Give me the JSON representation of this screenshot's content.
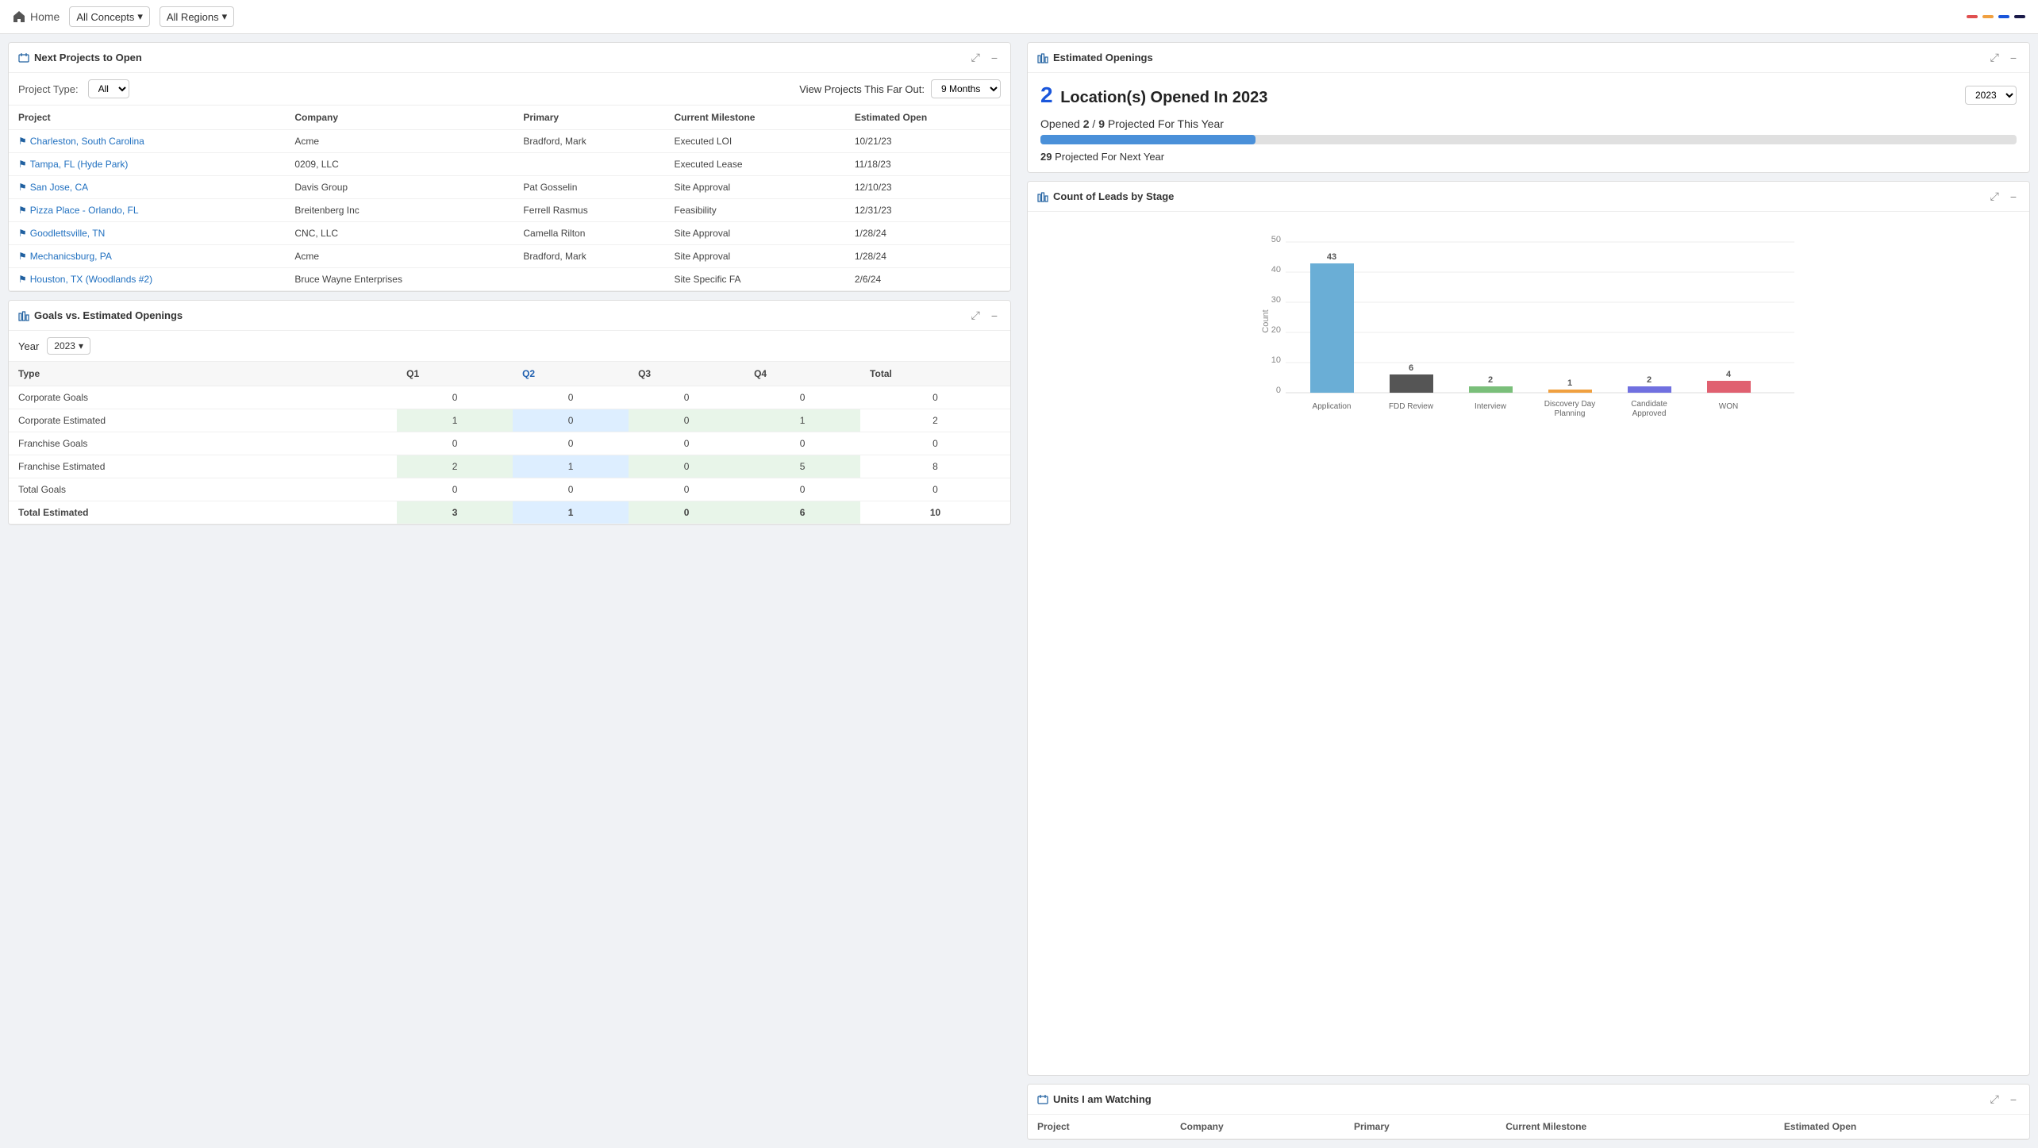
{
  "topbar": {
    "home_label": "Home",
    "concepts_label": "All Concepts",
    "regions_label": "All Regions",
    "colors": [
      "#e05050",
      "#f0a040",
      "#2060a0",
      "#1a1a4a"
    ]
  },
  "next_projects": {
    "title": "Next Projects to Open",
    "filter_label": "Project Type:",
    "filter_value": "All",
    "far_out_label": "View Projects This Far Out:",
    "far_out_value": "9 Months",
    "columns": [
      "Project",
      "Company",
      "Primary",
      "Current Milestone",
      "Estimated Open"
    ],
    "rows": [
      {
        "project": "Charleston, South Carolina",
        "company": "Acme",
        "primary": "Bradford, Mark",
        "milestone": "Executed LOI",
        "est_open": "10/21/23"
      },
      {
        "project": "Tampa, FL (Hyde Park)",
        "company": "0209, LLC",
        "primary": "",
        "milestone": "Executed Lease",
        "est_open": "11/18/23"
      },
      {
        "project": "San Jose, CA",
        "company": "Davis Group",
        "primary": "Pat Gosselin",
        "milestone": "Site Approval",
        "est_open": "12/10/23"
      },
      {
        "project": "Pizza Place - Orlando, FL",
        "company": "Breitenberg Inc",
        "primary": "Ferrell Rasmus",
        "milestone": "Feasibility",
        "est_open": "12/31/23"
      },
      {
        "project": "Goodlettsville, TN",
        "company": "CNC, LLC",
        "primary": "Camella Rilton",
        "milestone": "Site Approval",
        "est_open": "1/28/24"
      },
      {
        "project": "Mechanicsburg, PA",
        "company": "Acme",
        "primary": "Bradford, Mark",
        "milestone": "Site Approval",
        "est_open": "1/28/24"
      },
      {
        "project": "Houston, TX (Woodlands #2)",
        "company": "Bruce Wayne Enterprises",
        "primary": "",
        "milestone": "Site Specific FA",
        "est_open": "2/6/24"
      }
    ]
  },
  "goals": {
    "title": "Goals vs. Estimated Openings",
    "year_label": "Year",
    "year_value": "2023",
    "columns": [
      "Type",
      "Q1",
      "Q2",
      "Q3",
      "Q4",
      "Total"
    ],
    "rows": [
      {
        "type": "Corporate Goals",
        "q1": "0",
        "q2": "0",
        "q3": "0",
        "q4": "0",
        "total": "0",
        "highlight": false
      },
      {
        "type": "Corporate Estimated",
        "q1": "1",
        "q2": "0",
        "q3": "0",
        "q4": "1",
        "total": "2",
        "highlight": true
      },
      {
        "type": "Franchise Goals",
        "q1": "0",
        "q2": "0",
        "q3": "0",
        "q4": "0",
        "total": "0",
        "highlight": false
      },
      {
        "type": "Franchise Estimated",
        "q1": "2",
        "q2": "1",
        "q3": "0",
        "q4": "5",
        "total": "8",
        "highlight": true
      },
      {
        "type": "Total Goals",
        "q1": "0",
        "q2": "0",
        "q3": "0",
        "q4": "0",
        "total": "0",
        "highlight": false
      },
      {
        "type": "Total Estimated",
        "q1": "3",
        "q2": "1",
        "q3": "0",
        "q4": "6",
        "total": "10",
        "highlight": true
      }
    ]
  },
  "estimated_openings": {
    "title": "Estimated Openings",
    "opened_count": "2",
    "opened_text": "Location(s) Opened In 2023",
    "year": "2023",
    "progress_text_1": "Opened",
    "progress_opened": "2",
    "progress_separator": "/",
    "progress_total": "9",
    "progress_text_2": "Projected For This Year",
    "progress_pct": 22,
    "projected_next_num": "29",
    "projected_next_text": "Projected For Next Year"
  },
  "leads_chart": {
    "title": "Count of Leads by Stage",
    "y_axis_label": "Count",
    "y_ticks": [
      "0",
      "10",
      "20",
      "30",
      "40",
      "50"
    ],
    "bars": [
      {
        "label": "Application",
        "value": 43,
        "color": "#6aaed6"
      },
      {
        "label": "FDD Review",
        "value": 6,
        "color": "#555555"
      },
      {
        "label": "Interview",
        "value": 2,
        "color": "#7abf7a"
      },
      {
        "label": "Discovery Day\nPlanning",
        "value": 1,
        "color": "#f0a040"
      },
      {
        "label": "Candidate Approved",
        "value": 2,
        "color": "#7070e0"
      },
      {
        "label": "WON",
        "value": 4,
        "color": "#e06070"
      }
    ],
    "max_value": 50
  },
  "units_watching": {
    "title": "Units I am Watching",
    "columns": [
      "Project",
      "Company",
      "Primary",
      "Current Milestone",
      "Estimated Open"
    ]
  },
  "months_label": "Months"
}
